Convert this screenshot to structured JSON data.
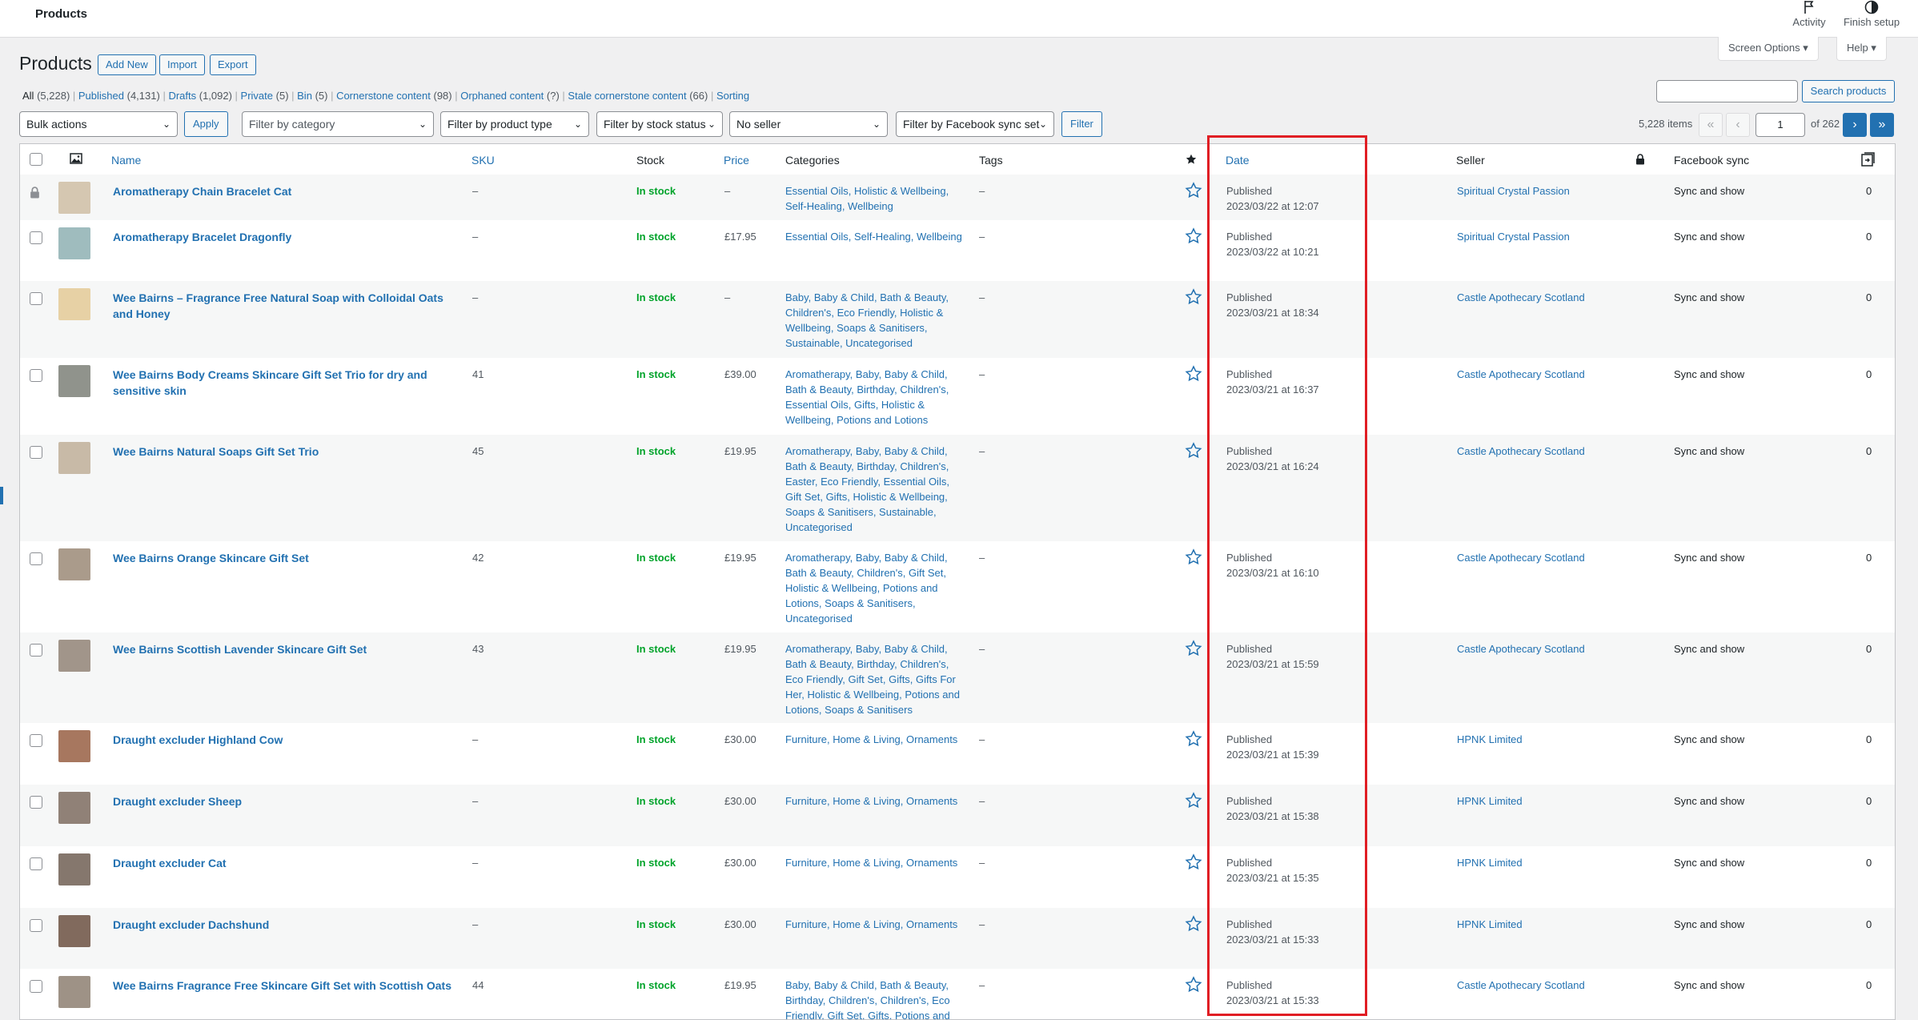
{
  "topbar": {
    "crumb": "Products",
    "activity": "Activity",
    "finish_setup": "Finish setup"
  },
  "header": {
    "title": "Products",
    "add_new": "Add New",
    "import": "Import",
    "export": "Export",
    "screen_options": "Screen Options ▾",
    "help": "Help ▾"
  },
  "views": [
    {
      "label": "All",
      "count": "(5,228)"
    },
    {
      "label": "Published",
      "count": "(4,131)"
    },
    {
      "label": "Drafts",
      "count": "(1,092)"
    },
    {
      "label": "Private",
      "count": "(5)"
    },
    {
      "label": "Bin",
      "count": "(5)"
    },
    {
      "label": "Cornerstone content",
      "count": "(98)"
    },
    {
      "label": "Orphaned content",
      "count": "(?)"
    },
    {
      "label": "Stale cornerstone content",
      "count": "(66)"
    },
    {
      "label": "Sorting",
      "count": ""
    }
  ],
  "search": {
    "button": "Search products",
    "value": ""
  },
  "filters": {
    "bulk_actions": "Bulk actions",
    "apply": "Apply",
    "category": "Filter by category",
    "product_type": "Filter by product type",
    "stock_status": "Filter by stock status",
    "seller": "No seller",
    "facebook": "Filter by Facebook sync set",
    "filter": "Filter"
  },
  "pagination": {
    "items": "5,228 items",
    "first": "«",
    "prev": "‹",
    "current": "1",
    "of": "of 262",
    "next": "›",
    "last": "»"
  },
  "columns": {
    "name": "Name",
    "sku": "SKU",
    "stock": "Stock",
    "price": "Price",
    "categories": "Categories",
    "tags": "Tags",
    "date": "Date",
    "seller": "Seller",
    "facebook_sync": "Facebook sync"
  },
  "rows": [
    {
      "name": "Aromatherapy Chain Bracelet Cat",
      "sku": "–",
      "stock": "In stock",
      "price": "–",
      "categories": "Essential Oils, Holistic & Wellbeing, Self-Healing, Wellbeing",
      "tags": "–",
      "status": "Published",
      "date": "2023/03/22 at 12:07",
      "seller": "Spiritual Crystal Passion",
      "fb": "Sync and show",
      "count": "0",
      "locked": true,
      "thumb_color": "#c9b79a"
    },
    {
      "name": "Aromatherapy Bracelet Dragonfly",
      "sku": "–",
      "stock": "In stock",
      "price": "£17.95",
      "categories": "Essential Oils, Self-Healing, Wellbeing",
      "tags": "–",
      "status": "Published",
      "date": "2023/03/22 at 10:21",
      "seller": "Spiritual Crystal Passion",
      "fb": "Sync and show",
      "count": "0",
      "locked": false,
      "thumb_color": "#7fa5a8"
    },
    {
      "name": "Wee Bairns – Fragrance Free Natural Soap with Colloidal Oats and Honey",
      "sku": "–",
      "stock": "In stock",
      "price": "–",
      "categories": "Baby, Baby & Child, Bath & Beauty, Children's, Eco Friendly, Holistic & Wellbeing, Soaps & Sanitisers, Sustainable, Uncategorised",
      "tags": "–",
      "status": "Published",
      "date": "2023/03/21 at 18:34",
      "seller": "Castle Apothecary Scotland",
      "fb": "Sync and show",
      "count": "0",
      "locked": false,
      "thumb_color": "#e2c48a"
    },
    {
      "name": "Wee Bairns Body Creams Skincare Gift Set Trio for dry and sensitive skin",
      "sku": "41",
      "stock": "In stock",
      "price": "£39.00",
      "categories": "Aromatherapy, Baby, Baby & Child, Bath & Beauty, Birthday, Children's, Essential Oils, Gifts, Holistic & Wellbeing, Potions and Lotions",
      "tags": "–",
      "status": "Published",
      "date": "2023/03/21 at 16:37",
      "seller": "Castle Apothecary Scotland",
      "fb": "Sync and show",
      "count": "0",
      "locked": false,
      "thumb_color": "#6b6f66"
    },
    {
      "name": "Wee Bairns Natural Soaps Gift Set Trio",
      "sku": "45",
      "stock": "In stock",
      "price": "£19.95",
      "categories": "Aromatherapy, Baby, Baby & Child, Bath & Beauty, Birthday, Children's, Easter, Eco Friendly, Essential Oils, Gift Set, Gifts, Holistic & Wellbeing, Soaps & Sanitisers, Sustainable, Uncategorised",
      "tags": "–",
      "status": "Published",
      "date": "2023/03/21 at 16:24",
      "seller": "Castle Apothecary Scotland",
      "fb": "Sync and show",
      "count": "0",
      "locked": false,
      "thumb_color": "#b8a58c"
    },
    {
      "name": "Wee Bairns Orange Skincare Gift Set",
      "sku": "42",
      "stock": "In stock",
      "price": "£19.95",
      "categories": "Aromatherapy, Baby, Baby & Child, Bath & Beauty, Children's, Gift Set, Holistic & Wellbeing, Potions and Lotions, Soaps & Sanitisers, Uncategorised",
      "tags": "–",
      "status": "Published",
      "date": "2023/03/21 at 16:10",
      "seller": "Castle Apothecary Scotland",
      "fb": "Sync and show",
      "count": "0",
      "locked": false,
      "thumb_color": "#8e7a64"
    },
    {
      "name": "Wee Bairns Scottish Lavender Skincare Gift Set",
      "sku": "43",
      "stock": "In stock",
      "price": "£19.95",
      "categories": "Aromatherapy, Baby, Baby & Child, Bath & Beauty, Birthday, Children's, Eco Friendly, Gift Set, Gifts, Gifts For Her, Holistic & Wellbeing, Potions and Lotions, Soaps & Sanitisers",
      "tags": "–",
      "status": "Published",
      "date": "2023/03/21 at 15:59",
      "seller": "Castle Apothecary Scotland",
      "fb": "Sync and show",
      "count": "0",
      "locked": false,
      "thumb_color": "#847466"
    },
    {
      "name": "Draught excluder Highland Cow",
      "sku": "–",
      "stock": "In stock",
      "price": "£30.00",
      "categories": "Furniture, Home & Living, Ornaments",
      "tags": "–",
      "status": "Published",
      "date": "2023/03/21 at 15:39",
      "seller": "HPNK Limited",
      "fb": "Sync and show",
      "count": "0",
      "locked": false,
      "thumb_color": "#8a4a2a"
    },
    {
      "name": "Draught excluder Sheep",
      "sku": "–",
      "stock": "In stock",
      "price": "£30.00",
      "categories": "Furniture, Home & Living, Ornaments",
      "tags": "–",
      "status": "Published",
      "date": "2023/03/21 at 15:38",
      "seller": "HPNK Limited",
      "fb": "Sync and show",
      "count": "0",
      "locked": false,
      "thumb_color": "#6d5a4c"
    },
    {
      "name": "Draught excluder Cat",
      "sku": "–",
      "stock": "In stock",
      "price": "£30.00",
      "categories": "Furniture, Home & Living, Ornaments",
      "tags": "–",
      "status": "Published",
      "date": "2023/03/21 at 15:35",
      "seller": "HPNK Limited",
      "fb": "Sync and show",
      "count": "0",
      "locked": false,
      "thumb_color": "#5c4a3c"
    },
    {
      "name": "Draught excluder Dachshund",
      "sku": "–",
      "stock": "In stock",
      "price": "£30.00",
      "categories": "Furniture, Home & Living, Ornaments",
      "tags": "–",
      "status": "Published",
      "date": "2023/03/21 at 15:33",
      "seller": "HPNK Limited",
      "fb": "Sync and show",
      "count": "0",
      "locked": false,
      "thumb_color": "#5a3b2a"
    },
    {
      "name": "Wee Bairns Fragrance Free Skincare Gift Set with Scottish Oats",
      "sku": "44",
      "stock": "In stock",
      "price": "£19.95",
      "categories": "Baby, Baby & Child, Bath & Beauty, Birthday, Children's, Children's, Eco Friendly, Gift Set, Gifts, Potions and",
      "tags": "–",
      "status": "Published",
      "date": "2023/03/21 at 15:33",
      "seller": "Castle Apothecary Scotland",
      "fb": "Sync and show",
      "count": "0",
      "locked": false,
      "thumb_color": "#7d6e5e"
    }
  ],
  "icons": {
    "activity": "flag-icon",
    "finish_setup": "half-circle-icon",
    "thumbnail_col": "image-icon",
    "featured_col": "star-icon",
    "seller_lock": "lock-icon",
    "fb_col": "sync-icon"
  },
  "colors": {
    "link": "#2271b1",
    "in_stock": "#00a32a",
    "highlight": "#e01e24"
  }
}
